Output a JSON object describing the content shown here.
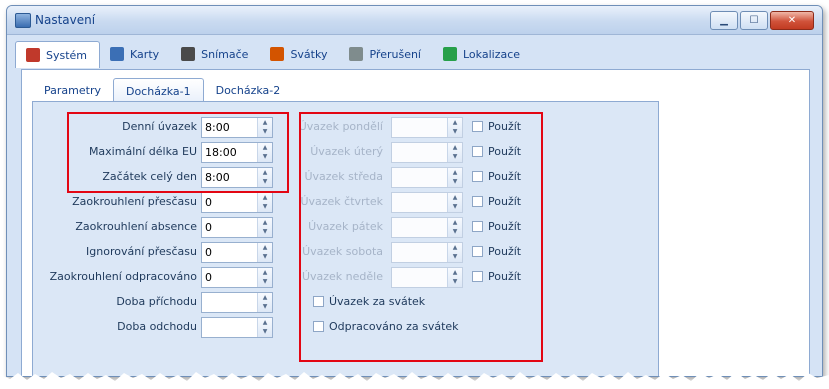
{
  "window": {
    "title": "Nastavení"
  },
  "main_tabs": [
    {
      "label": "Systém",
      "icon": "checklist-icon",
      "color": "#c0392b"
    },
    {
      "label": "Karty",
      "icon": "cards-icon",
      "color": "#3b6fb5"
    },
    {
      "label": "Snímače",
      "icon": "reader-icon",
      "color": "#4a4a4a"
    },
    {
      "label": "Svátky",
      "icon": "calendar-icon",
      "color": "#d35400"
    },
    {
      "label": "Přerušení",
      "icon": "door-icon",
      "color": "#7f8c8d"
    },
    {
      "label": "Lokalizace",
      "icon": "globe-icon",
      "color": "#27a04a"
    }
  ],
  "sub_tabs": [
    {
      "label": "Parametry"
    },
    {
      "label": "Docházka-1"
    },
    {
      "label": "Docházka-2"
    }
  ],
  "left_fields": [
    {
      "label": "Denní úvazek",
      "value": "8:00"
    },
    {
      "label": "Maximální délka EU",
      "value": "18:00"
    },
    {
      "label": "Začátek celý den",
      "value": "8:00"
    },
    {
      "label": "Zaokrouhlení přesčasu",
      "value": "0"
    },
    {
      "label": "Zaokrouhlení absence",
      "value": "0"
    },
    {
      "label": "Ignorování přesčasu",
      "value": "0"
    },
    {
      "label": "Zaokrouhlení odpracováno",
      "value": "0"
    },
    {
      "label": "Doba příchodu",
      "value": ""
    },
    {
      "label": "Doba odchodu",
      "value": ""
    }
  ],
  "day_fields": [
    {
      "label": "Úvazek pondělí",
      "check": "Použít"
    },
    {
      "label": "Úvazek úterý",
      "check": "Použít"
    },
    {
      "label": "Úvazek středa",
      "check": "Použít"
    },
    {
      "label": "Úvazek čtvrtek",
      "check": "Použít"
    },
    {
      "label": "Úvazek pátek",
      "check": "Použít"
    },
    {
      "label": "Úvazek sobota",
      "check": "Použít"
    },
    {
      "label": "Úvazek neděle",
      "check": "Použít"
    }
  ],
  "extra_checks": [
    {
      "label": "Úvazek za svátek"
    },
    {
      "label": "Odpracováno za svátek"
    }
  ],
  "accent": "#e30613"
}
